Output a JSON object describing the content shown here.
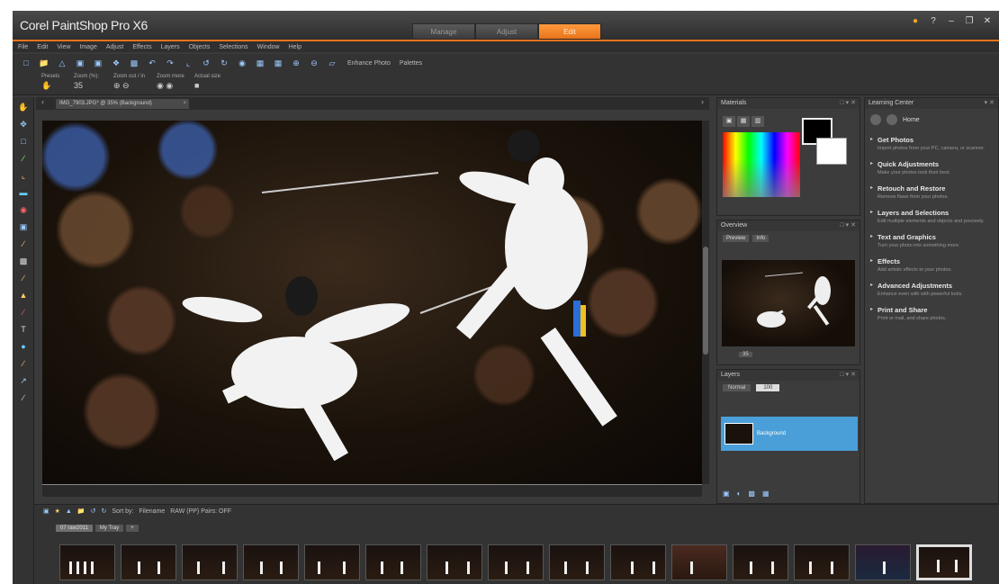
{
  "app": {
    "title": "Corel PaintShop Pro X6"
  },
  "workspace_tabs": [
    "Manage",
    "Adjust",
    "Edit"
  ],
  "active_tab": "Edit",
  "menu": [
    "File",
    "Edit",
    "View",
    "Image",
    "Adjust",
    "Effects",
    "Layers",
    "Objects",
    "Selections",
    "Window",
    "Help"
  ],
  "toolbar": {
    "enhance_photo": "Enhance Photo",
    "palettes": "Palettes"
  },
  "tool_options": [
    "Presets",
    "Zoom (%):",
    "Zoom out / in",
    "Zoom more",
    "Actual size"
  ],
  "document_tab": {
    "label": "IMG_7903.JPG* @ 35% (Background)"
  },
  "panels": {
    "materials": {
      "title": "Materials"
    },
    "overview": {
      "title": "Overview",
      "tabs": [
        "Preview",
        "Info"
      ],
      "zoom": "35"
    },
    "layers": {
      "title": "Layers",
      "blend": "Normal",
      "opacity": "100",
      "layer_name": "Background"
    },
    "learning": {
      "title": "Learning Center",
      "home": "Home",
      "items": [
        {
          "title": "Get Photos",
          "desc": "Import photos from your PC, camera, or scanner."
        },
        {
          "title": "Quick Adjustments",
          "desc": "Make your photos look their best."
        },
        {
          "title": "Retouch and Restore",
          "desc": "Remove flaws from your photos."
        },
        {
          "title": "Layers and Selections",
          "desc": "Edit multiple elements and objects and precisely."
        },
        {
          "title": "Text and Graphics",
          "desc": "Turn your photo into something more."
        },
        {
          "title": "Effects",
          "desc": "Add artistic effects to your photos."
        },
        {
          "title": "Advanced Adjustments",
          "desc": "Enhance even with with powerful tools."
        },
        {
          "title": "Print and Share",
          "desc": "Print or mail, and share photos."
        }
      ]
    }
  },
  "organizer": {
    "sort_label": "Sort by:",
    "sort_value": "Filename",
    "filter": "RAW (PP) Pairs: OFF",
    "tabs": [
      "07 raw2011",
      "My Tray"
    ]
  }
}
